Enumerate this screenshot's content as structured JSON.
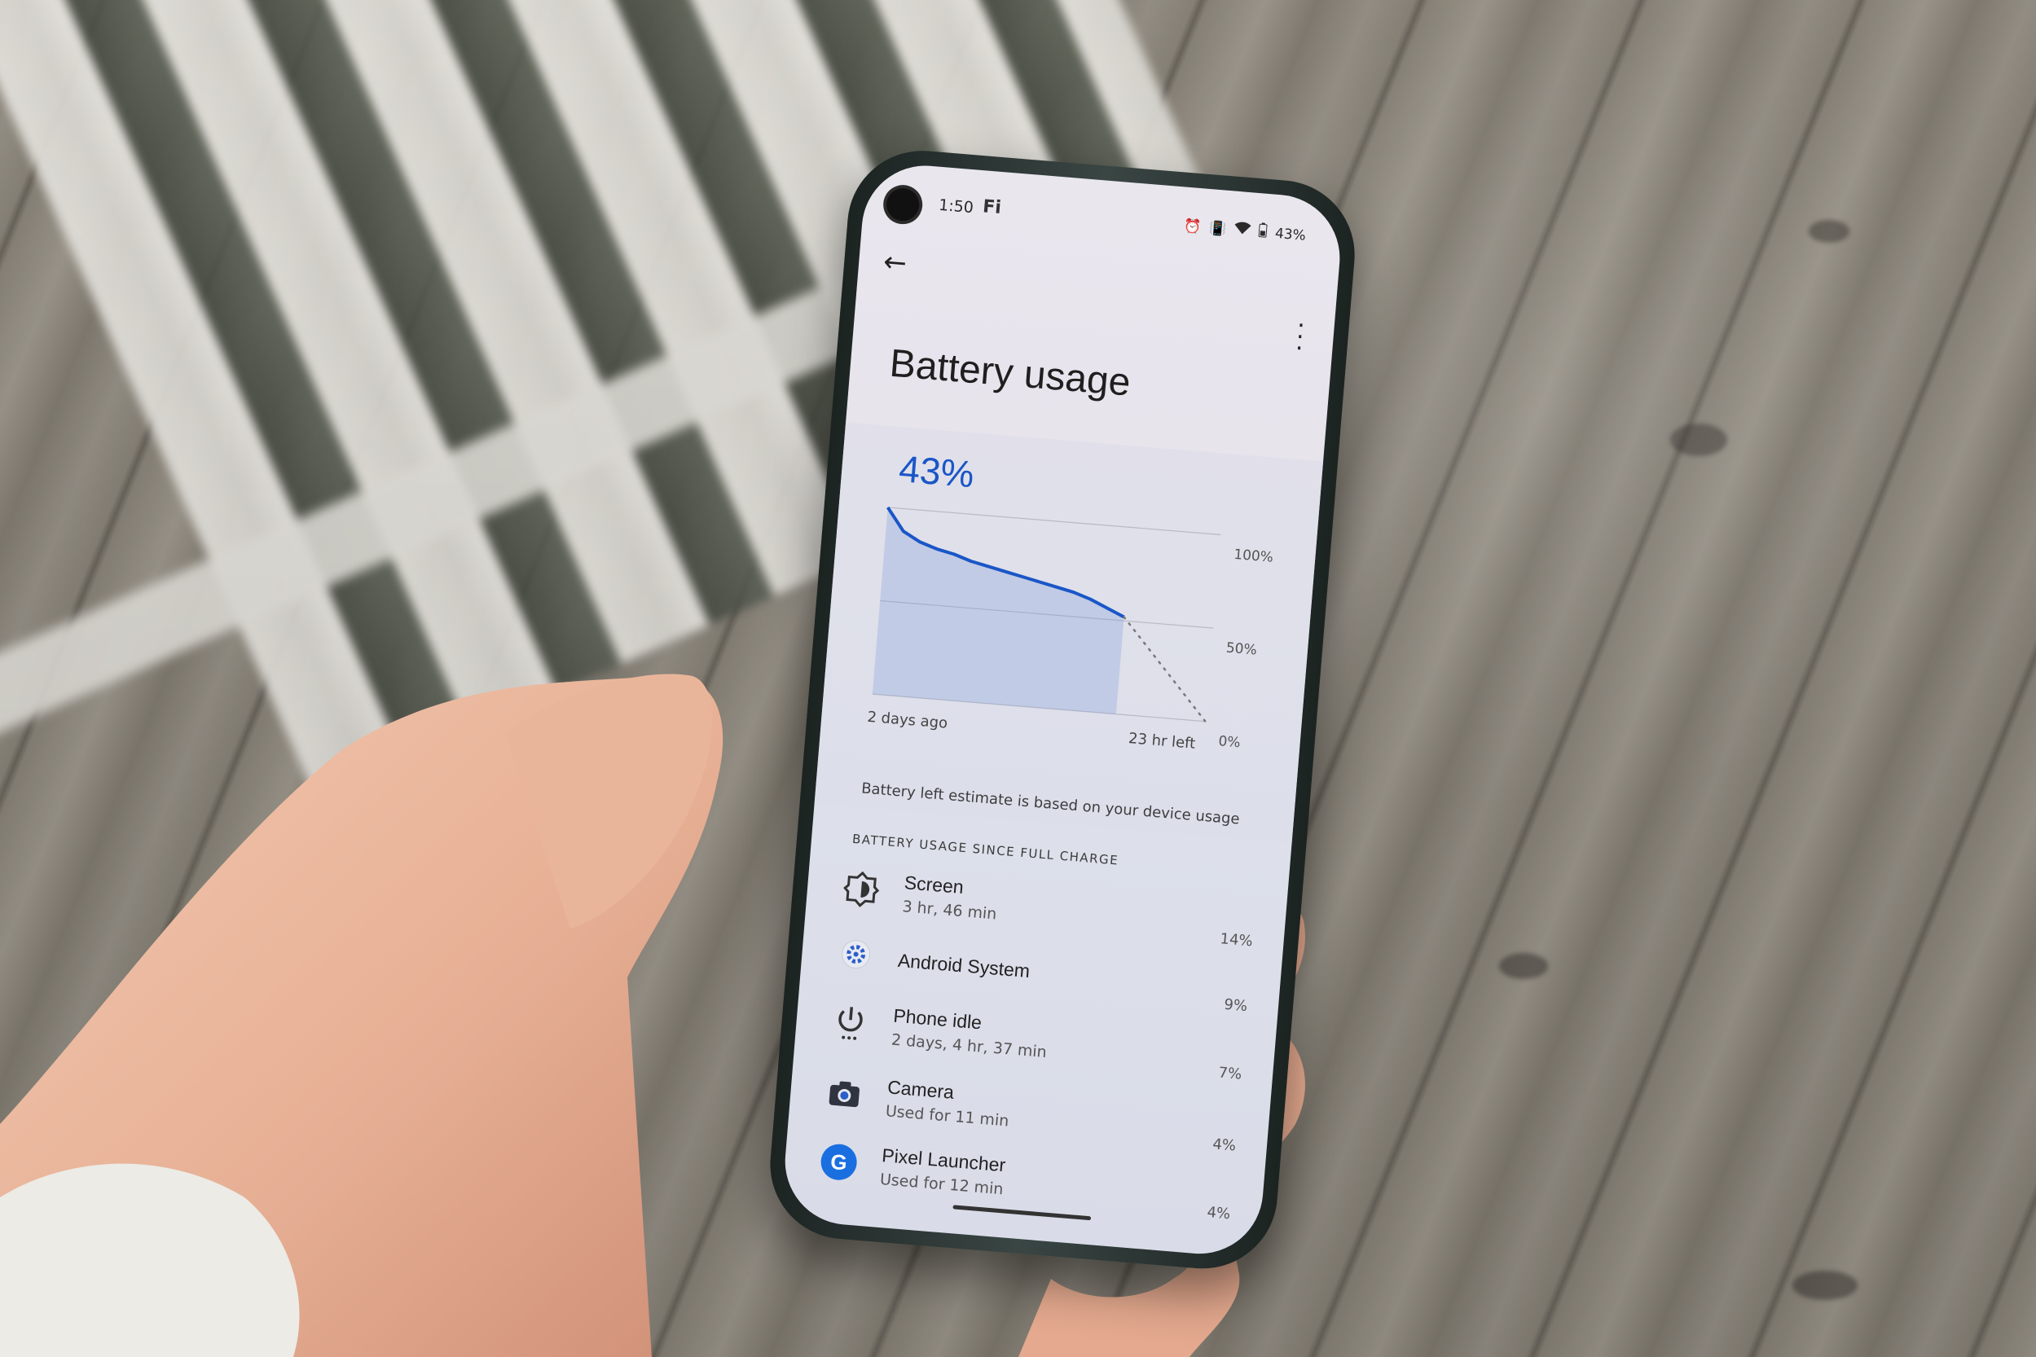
{
  "status_bar": {
    "time": "1:50",
    "carrier_mark": "Fi",
    "battery_percent": "43%",
    "icons": [
      "alarm-icon",
      "vibrate-icon",
      "wifi-icon",
      "battery-icon"
    ]
  },
  "header": {
    "back_glyph": "←",
    "title": "Battery usage",
    "menu_glyph": "⋮"
  },
  "battery_chart": {
    "level_label": "43%",
    "y_ticks": [
      "100%",
      "50%",
      "0%"
    ],
    "x_start_label": "2 days ago",
    "x_end_label": "23 hr left",
    "estimate_note": "Battery left estimate is based on your device usage",
    "accent_color": "#1a56c7"
  },
  "chart_data": {
    "type": "line",
    "series": [
      {
        "values": [
          100,
          88,
          83,
          80,
          78,
          75,
          73,
          71,
          69,
          67,
          65,
          63,
          60,
          56,
          52
        ]
      },
      {
        "values": [
          52,
          39,
          26,
          13,
          0
        ]
      }
    ],
    "ylim": [
      0,
      100
    ]
  },
  "usage": {
    "section_label": "BATTERY USAGE SINCE FULL CHARGE",
    "items": [
      {
        "icon": "brightness-icon",
        "name": "Screen",
        "detail": "3 hr, 46 min",
        "percent": "14%"
      },
      {
        "icon": "gear-icon",
        "name": "Android System",
        "detail": "",
        "percent": "9%"
      },
      {
        "icon": "power-icon",
        "name": "Phone idle",
        "detail": "2 days, 4 hr, 37 min",
        "percent": "7%"
      },
      {
        "icon": "camera-icon",
        "name": "Camera",
        "detail": "Used for 11 min",
        "percent": "4%"
      },
      {
        "icon": "google-g-icon",
        "badge": "G",
        "name": "Pixel Launcher",
        "detail": "Used for 12 min",
        "percent": "4%"
      }
    ]
  }
}
